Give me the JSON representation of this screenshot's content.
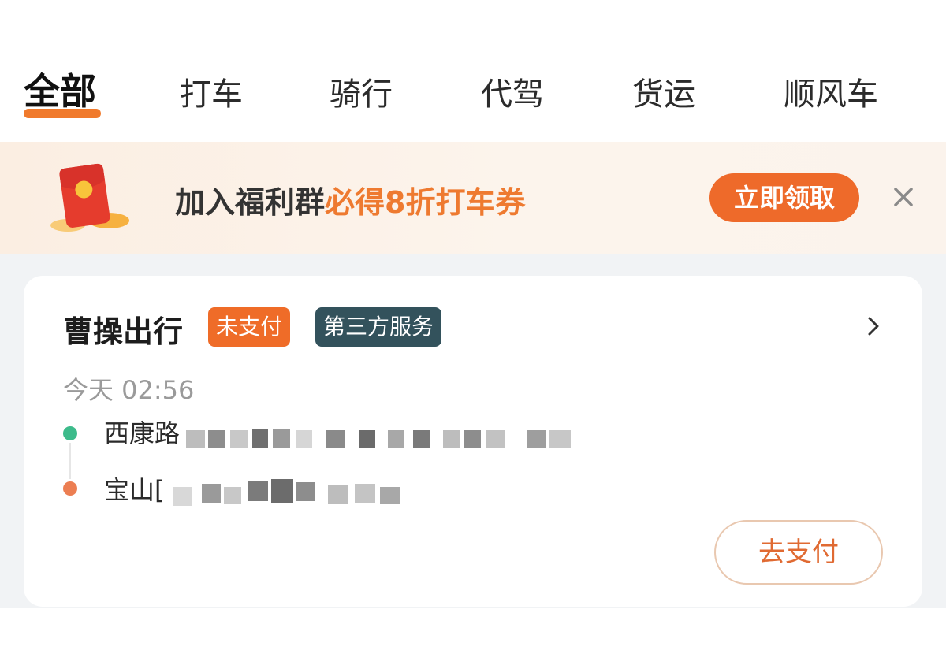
{
  "tabs": {
    "items": [
      {
        "label": "全部",
        "active": true
      },
      {
        "label": "打车",
        "active": false
      },
      {
        "label": "骑行",
        "active": false
      },
      {
        "label": "代驾",
        "active": false
      },
      {
        "label": "货运",
        "active": false
      },
      {
        "label": "顺风车",
        "active": false
      }
    ],
    "accent_color": "#f07a2c"
  },
  "banner": {
    "text_prefix": "加入福利群",
    "text_highlight": "必得8折打车券",
    "claim_label": "立即领取",
    "close_icon": "close-icon",
    "envelope_icon": "red-envelope-icon",
    "highlight_color": "#ee7a30",
    "button_color": "#ee6a2a"
  },
  "order": {
    "provider": "曹操出行",
    "status_badge": "未支付",
    "service_badge": "第三方服务",
    "time": "今天 02:56",
    "start_address": "西康路",
    "end_address": "宝山[",
    "pay_label": "去支付",
    "chevron_icon": "chevron-right-icon",
    "start_dot_color": "#3dbb8b",
    "end_dot_color": "#ec7e52"
  }
}
